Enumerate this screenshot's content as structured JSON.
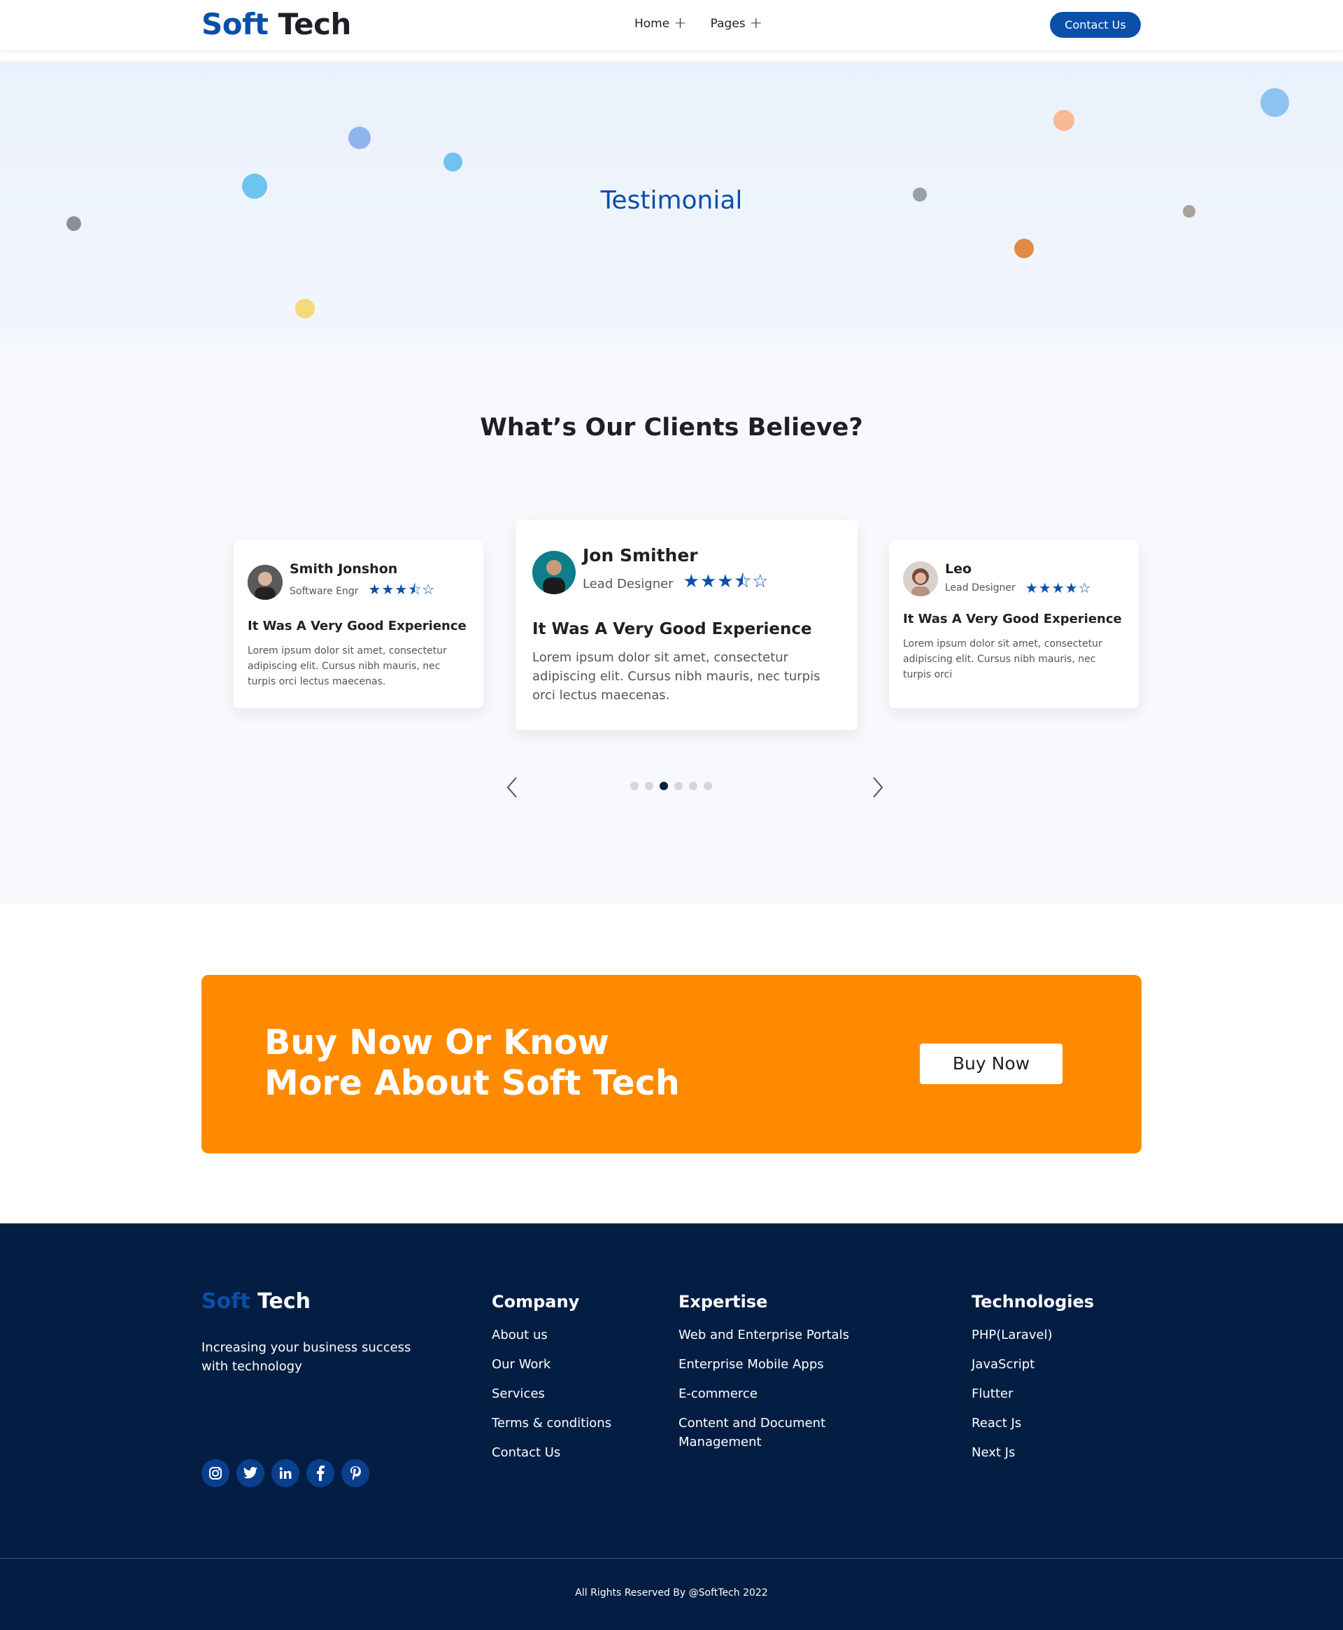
{
  "header": {
    "logo": {
      "first": "Soft",
      "second": "Tech"
    },
    "nav": [
      {
        "label": "Home",
        "icon": "plus-icon"
      },
      {
        "label": "Pages",
        "icon": "plus-icon"
      }
    ],
    "contact_label": "Contact Us"
  },
  "hero": {
    "title": "Testimonial",
    "dot_colors": [
      "#8fb3ee",
      "#6ec3ef",
      "#6ec3ef",
      "#8e8e92",
      "#f5d97a",
      "#98a0ac",
      "#f7b996",
      "#e08a45",
      "#a8a39a",
      "#8cc3f0"
    ]
  },
  "testimonials": {
    "heading": "What’s Our Clients Believe?",
    "cards": [
      {
        "name": "Smith Jonshon",
        "role": "Software Engr",
        "stars": "★★★⯪☆",
        "rating": 3.5,
        "title": "It Was A Very Good Experience",
        "text": "Lorem ipsum dolor sit amet, consectetur adipiscing elit. Cursus nibh mauris, nec turpis orci lectus maecenas."
      },
      {
        "name": "Jon Smither",
        "role": "Lead Designer",
        "stars": "★★★⯪☆",
        "rating": 3.5,
        "title": "It Was A Very Good Experience",
        "text": "Lorem ipsum dolor sit amet, consectetur adipiscing elit. Cursus nibh mauris, nec turpis orci lectus maecenas."
      },
      {
        "name": "Leo",
        "role": "Lead Designer",
        "stars": "★★★★☆",
        "rating": 4,
        "title": "It Was A Very Good Experience",
        "text": "Lorem ipsum dolor sit amet, consectetur adipiscing elit. Cursus nibh mauris, nec turpis orci"
      }
    ],
    "pager": {
      "count": 6,
      "active_index": 2
    }
  },
  "cta": {
    "title": "Buy Now Or Know More About Soft Tech",
    "button": "Buy Now",
    "color": "#ff8a00"
  },
  "footer": {
    "logo": {
      "first": "Soft",
      "second": "Tech"
    },
    "tagline": "Increasing your business success with technology",
    "socials": [
      "instagram-icon",
      "twitter-icon",
      "linkedin-icon",
      "facebook-icon",
      "pinterest-icon"
    ],
    "columns": [
      {
        "title": "Company",
        "links": [
          "About us",
          "Our Work",
          "Services",
          "Terms & conditions",
          "Contact Us"
        ]
      },
      {
        "title": "Expertise",
        "links": [
          "Web and Enterprise Portals",
          "Enterprise Mobile Apps",
          "E-commerce",
          "Content and Document Management"
        ]
      },
      {
        "title": "Technologies",
        "links": [
          "PHP(Laravel)",
          "JavaScript",
          "Flutter",
          "React Js",
          "Next Js"
        ]
      }
    ],
    "copyright": "All Rights Reserved By @SoftTech 2022"
  },
  "colors": {
    "brand": "#0a4fa8",
    "footer_bg": "#041e43",
    "cta": "#ff8a00"
  }
}
